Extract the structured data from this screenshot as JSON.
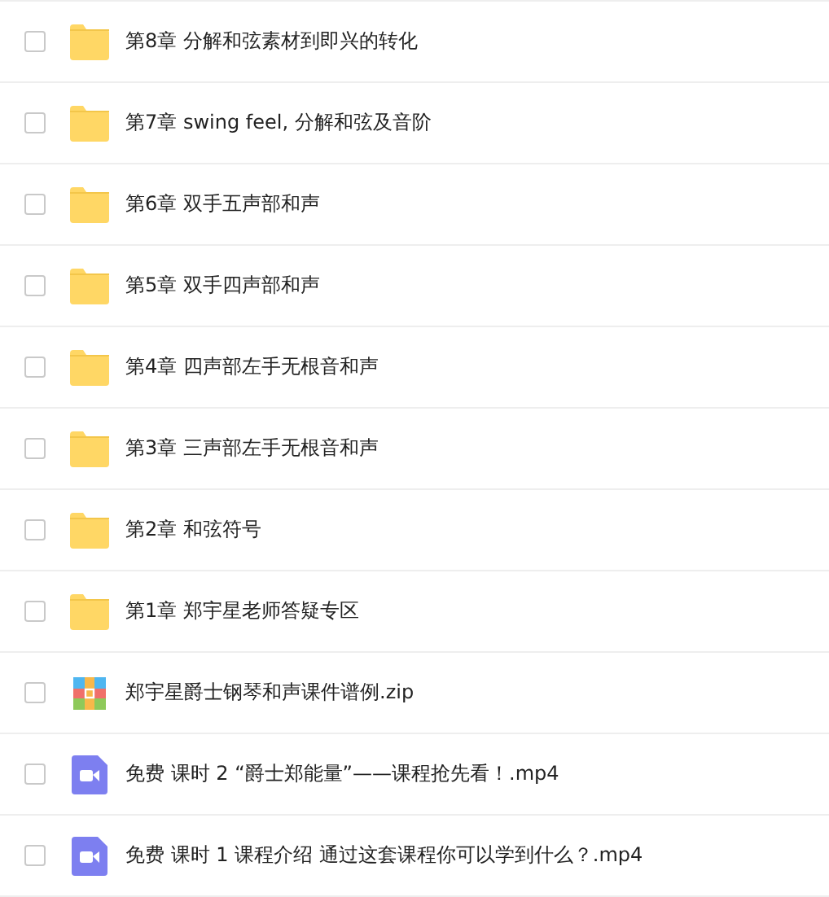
{
  "files": [
    {
      "kind": "folder",
      "name": "第8章 分解和弦素材到即兴的转化",
      "checked": false
    },
    {
      "kind": "folder",
      "name": "第7章 swing feel, 分解和弦及音阶",
      "checked": false
    },
    {
      "kind": "folder",
      "name": "第6章 双手五声部和声",
      "checked": false
    },
    {
      "kind": "folder",
      "name": "第5章 双手四声部和声",
      "checked": false
    },
    {
      "kind": "folder",
      "name": "第4章 四声部左手无根音和声",
      "checked": false
    },
    {
      "kind": "folder",
      "name": "第3章 三声部左手无根音和声",
      "checked": false
    },
    {
      "kind": "folder",
      "name": "第2章 和弦符号",
      "checked": false
    },
    {
      "kind": "folder",
      "name": "第1章 郑宇星老师答疑专区",
      "checked": false
    },
    {
      "kind": "zip",
      "name": "郑宇星爵士钢琴和声课件谱例.zip",
      "checked": false
    },
    {
      "kind": "video",
      "name": "免费 课时 2 “爵士郑能量”——课程抢先看！.mp4",
      "checked": false
    },
    {
      "kind": "video",
      "name": "免费 课时 1 课程介绍 通过这套课程你可以学到什么？.mp4",
      "checked": false
    }
  ]
}
